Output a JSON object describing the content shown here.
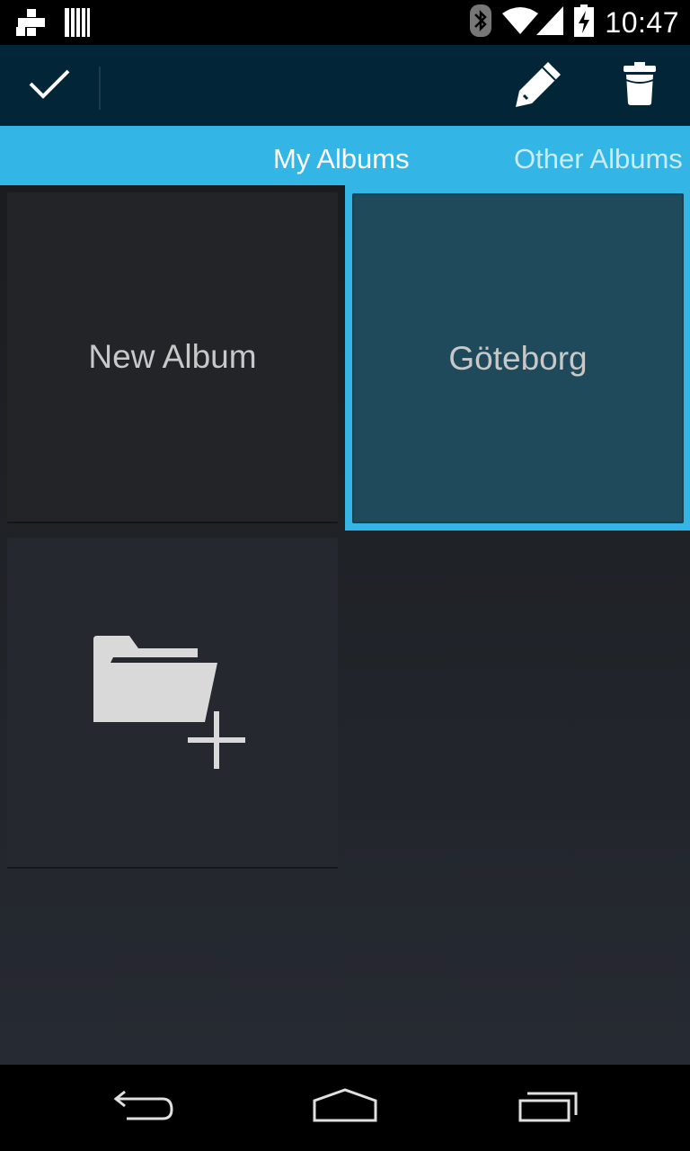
{
  "status_bar": {
    "time": "10:47",
    "icons": [
      "tunein-icon",
      "barcode-icon",
      "bluetooth-icon",
      "wifi-icon",
      "signal-icon",
      "battery-charging-icon"
    ]
  },
  "action_bar": {
    "actions": [
      "done-check-icon",
      "edit-pencil-icon",
      "delete-trash-icon"
    ]
  },
  "tabs": [
    {
      "label": "My Albums",
      "selected": true
    },
    {
      "label": "Other Albums",
      "selected": false
    }
  ],
  "albums": [
    {
      "label": "New Album",
      "selected": false
    },
    {
      "label": "Göteborg",
      "selected": true
    }
  ],
  "add_tile": {
    "icon": "add-folder-icon"
  },
  "nav_bar": {
    "buttons": [
      "back-icon",
      "home-icon",
      "recents-icon"
    ]
  },
  "colors": {
    "accent": "#33b5e5",
    "action_bar": "#022638",
    "selected_tile": "#1e4a5c",
    "tile": "#222427"
  }
}
